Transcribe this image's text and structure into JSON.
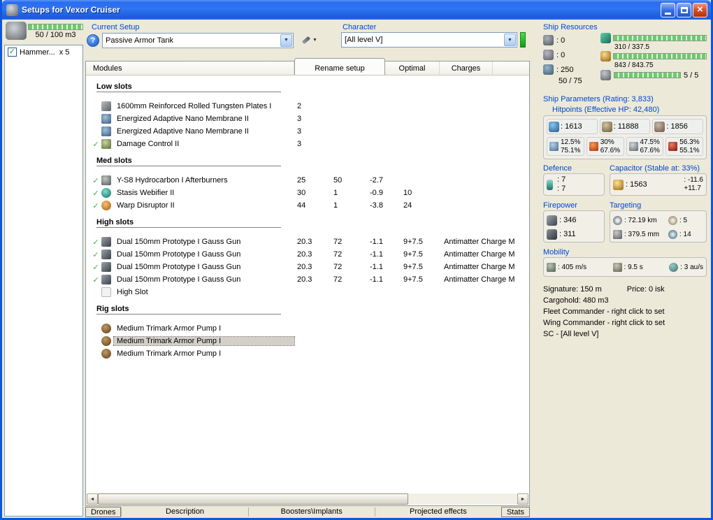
{
  "window": {
    "title": "Setups for Vexor Cruiser"
  },
  "sidebar": {
    "drone_capacity": "50 / 100 m3",
    "drones": [
      {
        "label": "Hammer...",
        "qty": "x 5"
      }
    ]
  },
  "setup_bar": {
    "current_setup_label": "Current Setup",
    "setup_name": "Passive Armor Tank",
    "character_label": "Character",
    "character_name": "[All level V]"
  },
  "module_list": {
    "header_modules": "Modules",
    "rename_tab": "Rename setup",
    "header_optimal": "Optimal",
    "header_charges": "Charges",
    "sections": [
      {
        "title": "Low slots",
        "rows": [
          {
            "check": "",
            "name": "1600mm Reinforced Rolled Tungsten Plates I",
            "c1": "2",
            "c2": "",
            "c3": "",
            "c4": "",
            "charge": ""
          },
          {
            "check": "",
            "name": "Energized Adaptive Nano Membrane II",
            "c1": "3",
            "c2": "",
            "c3": "",
            "c4": "",
            "charge": ""
          },
          {
            "check": "",
            "name": "Energized Adaptive Nano Membrane II",
            "c1": "3",
            "c2": "",
            "c3": "",
            "c4": "",
            "charge": ""
          },
          {
            "check": "✓",
            "name": "Damage Control II",
            "c1": "3",
            "c2": "",
            "c3": "",
            "c4": "",
            "charge": ""
          }
        ]
      },
      {
        "title": "Med slots",
        "rows": [
          {
            "check": "✓",
            "name": "Y-S8 Hydrocarbon I Afterburners",
            "c1": "25",
            "c2": "50",
            "c3": "-2.7",
            "c4": "",
            "charge": ""
          },
          {
            "check": "✓",
            "name": "Stasis Webifier II",
            "c1": "30",
            "c2": "1",
            "c3": "-0.9",
            "c4": "10",
            "charge": ""
          },
          {
            "check": "✓",
            "name": "Warp Disruptor II",
            "c1": "44",
            "c2": "1",
            "c3": "-3.8",
            "c4": "24",
            "charge": ""
          }
        ]
      },
      {
        "title": "High slots",
        "rows": [
          {
            "check": "✓",
            "name": "Dual 150mm Prototype I Gauss Gun",
            "c1": "20.3",
            "c2": "72",
            "c3": "-1.1",
            "c4": "9+7.5",
            "charge": "Antimatter Charge M"
          },
          {
            "check": "✓",
            "name": "Dual 150mm Prototype I Gauss Gun",
            "c1": "20.3",
            "c2": "72",
            "c3": "-1.1",
            "c4": "9+7.5",
            "charge": "Antimatter Charge M"
          },
          {
            "check": "✓",
            "name": "Dual 150mm Prototype I Gauss Gun",
            "c1": "20.3",
            "c2": "72",
            "c3": "-1.1",
            "c4": "9+7.5",
            "charge": "Antimatter Charge M"
          },
          {
            "check": "✓",
            "name": "Dual 150mm Prototype I Gauss Gun",
            "c1": "20.3",
            "c2": "72",
            "c3": "-1.1",
            "c4": "9+7.5",
            "charge": "Antimatter Charge M"
          },
          {
            "check": "",
            "name": "High Slot",
            "c1": "",
            "c2": "",
            "c3": "",
            "c4": "",
            "charge": ""
          }
        ]
      },
      {
        "title": "Rig slots",
        "rows": [
          {
            "check": "",
            "name": "Medium Trimark Armor Pump I",
            "c1": "",
            "c2": "",
            "c3": "",
            "c4": "",
            "charge": ""
          },
          {
            "check": "",
            "name": "Medium Trimark Armor Pump I",
            "c1": "",
            "c2": "",
            "c3": "",
            "c4": "",
            "charge": ""
          },
          {
            "check": "",
            "name": "Medium Trimark Armor Pump I",
            "c1": "",
            "c2": "",
            "c3": "",
            "c4": "",
            "charge": ""
          }
        ]
      }
    ]
  },
  "bottom_tabs": [
    "Drones",
    "Description",
    "Boosters\\Implants",
    "Projected effects",
    "Stats"
  ],
  "ship_resources": {
    "label": "Ship Resources",
    "turrets": ": 0",
    "launchers": ": 0",
    "calibration": ": 250",
    "drone_bandwidth": "50 / 75",
    "cpu": "310 / 337.5",
    "powergrid": "843 / 843.75",
    "drones": "5 / 5"
  },
  "ship_parameters": {
    "label": "Ship Parameters (Rating: 3,833)",
    "hitpoints_label": "Hitpoints (Effective HP: 42,480)",
    "shield_hp": ": 1613",
    "armor_hp": ": 11888",
    "hull_hp": ": 1856",
    "resists": [
      {
        "type": "em",
        "shield": "12.5%",
        "armor": "75.1%"
      },
      {
        "type": "thermal",
        "shield": "30%",
        "armor": "67.6%"
      },
      {
        "type": "kinetic",
        "shield": "47.5%",
        "armor": "67.6%"
      },
      {
        "type": "explosive",
        "shield": "56.3%",
        "armor": "55.1%"
      }
    ]
  },
  "defence": {
    "label": "Defence",
    "v1": ": 7",
    "v2": ": 7"
  },
  "capacitor": {
    "label": "Capacitor (Stable at: 33%)",
    "amount": ": 1563",
    "drain": ": -11.6",
    "recharge": "+11.7"
  },
  "firepower": {
    "label": "Firepower",
    "dps": ": 346",
    "volley": ": 311"
  },
  "targeting": {
    "label": "Targeting",
    "range": ": 72.19 km",
    "max_targets": ": 5",
    "scan_res": ": 379.5 mm",
    "sensor_strength": ": 14"
  },
  "mobility": {
    "label": "Mobility",
    "speed": ": 405 m/s",
    "align": ": 9.5 s",
    "warp": ": 3 au/s"
  },
  "info": {
    "signature": "Signature: 150 m",
    "price": "Price: 0 isk",
    "cargohold": "Cargohold: 480 m3",
    "fleet": "Fleet Commander - right click to set",
    "wing": "Wing Commander - right click to set",
    "sc": "SC - [All level V]"
  }
}
